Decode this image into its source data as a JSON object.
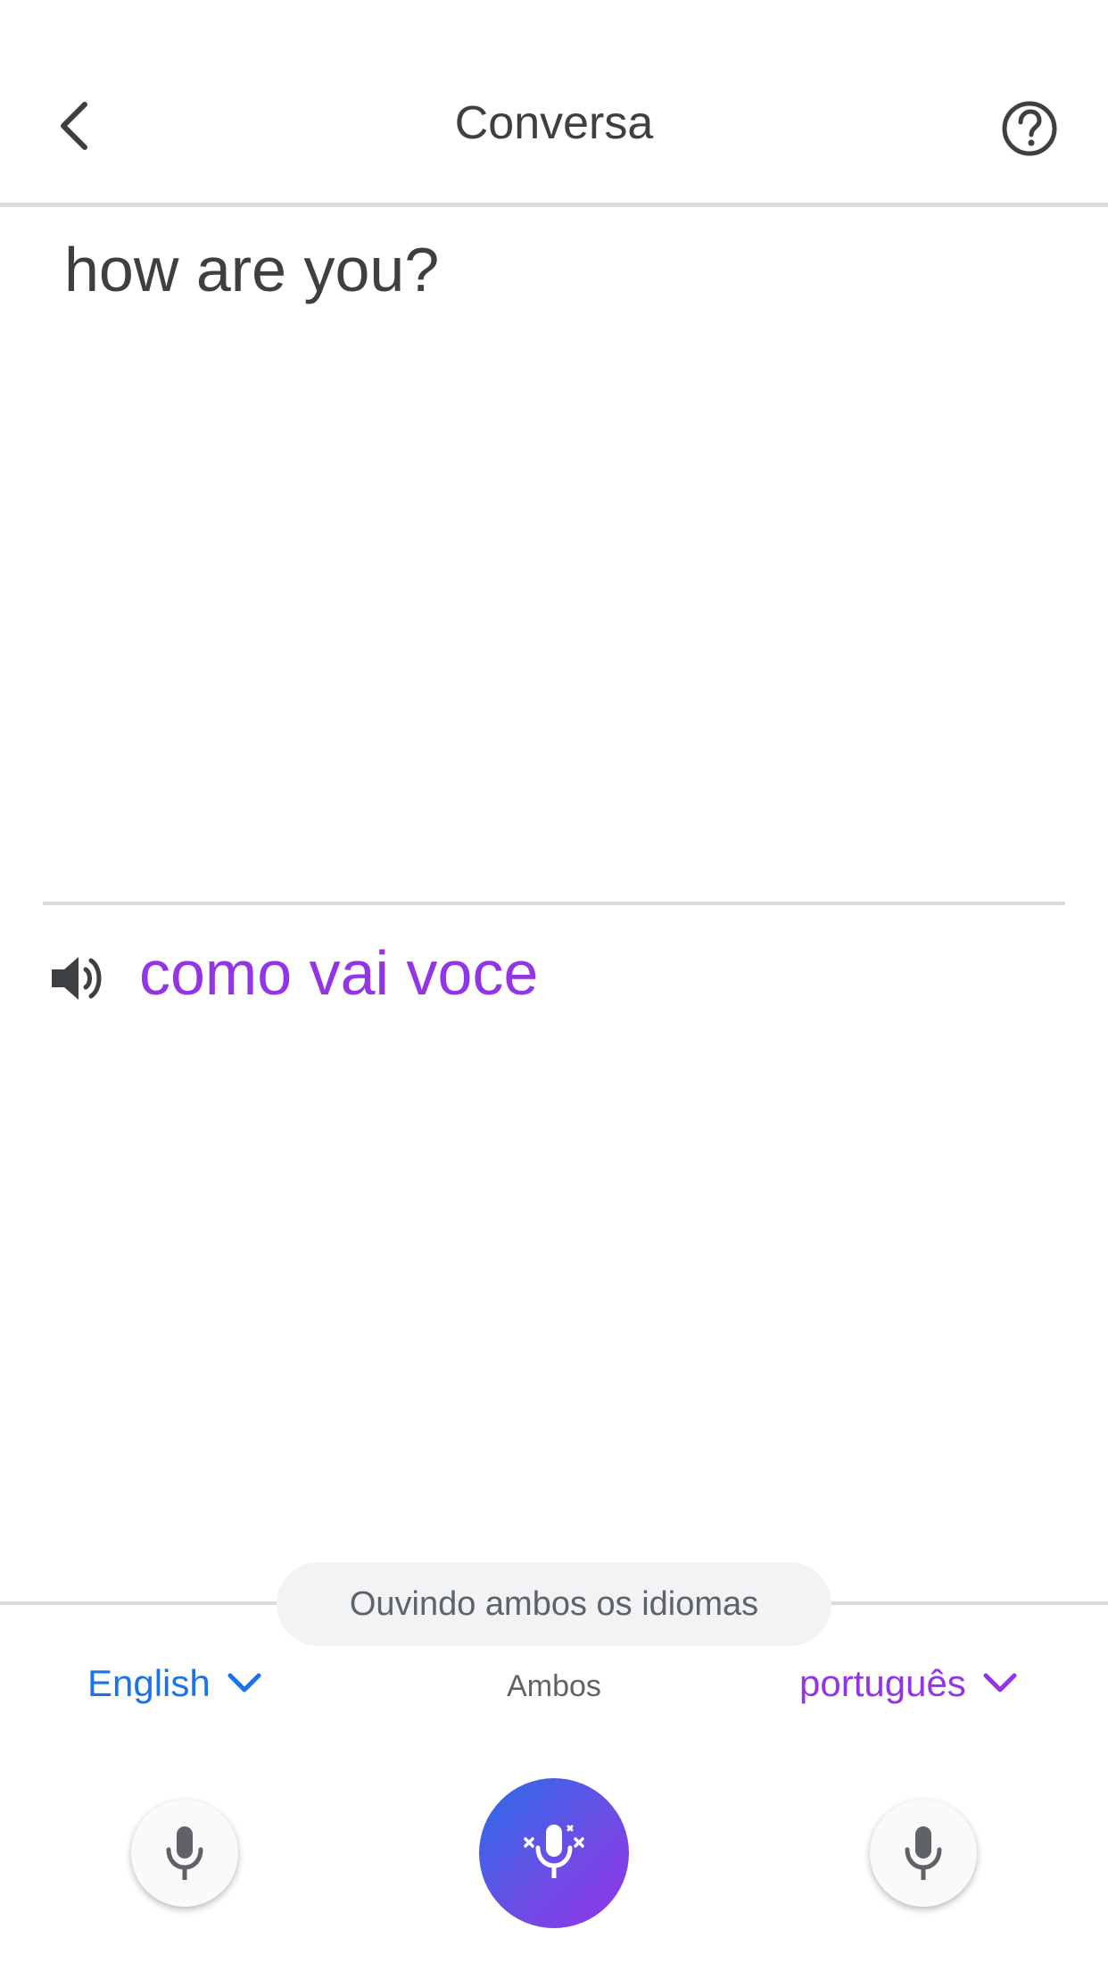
{
  "header": {
    "title": "Conversa",
    "back_icon": "chevron-left-icon",
    "help_icon": "help-circle-icon"
  },
  "conversation": {
    "source_text": "how are you?",
    "translated_text": "como vai voce",
    "speaker_icon": "volume-icon"
  },
  "status_chip": "Ouvindo ambos os idiomas",
  "languages": {
    "left": "English",
    "middle": "Ambos",
    "right": "português"
  },
  "colors": {
    "source_language": "#1a73e8",
    "target_language": "#9334e6",
    "text": "#3c4043"
  }
}
